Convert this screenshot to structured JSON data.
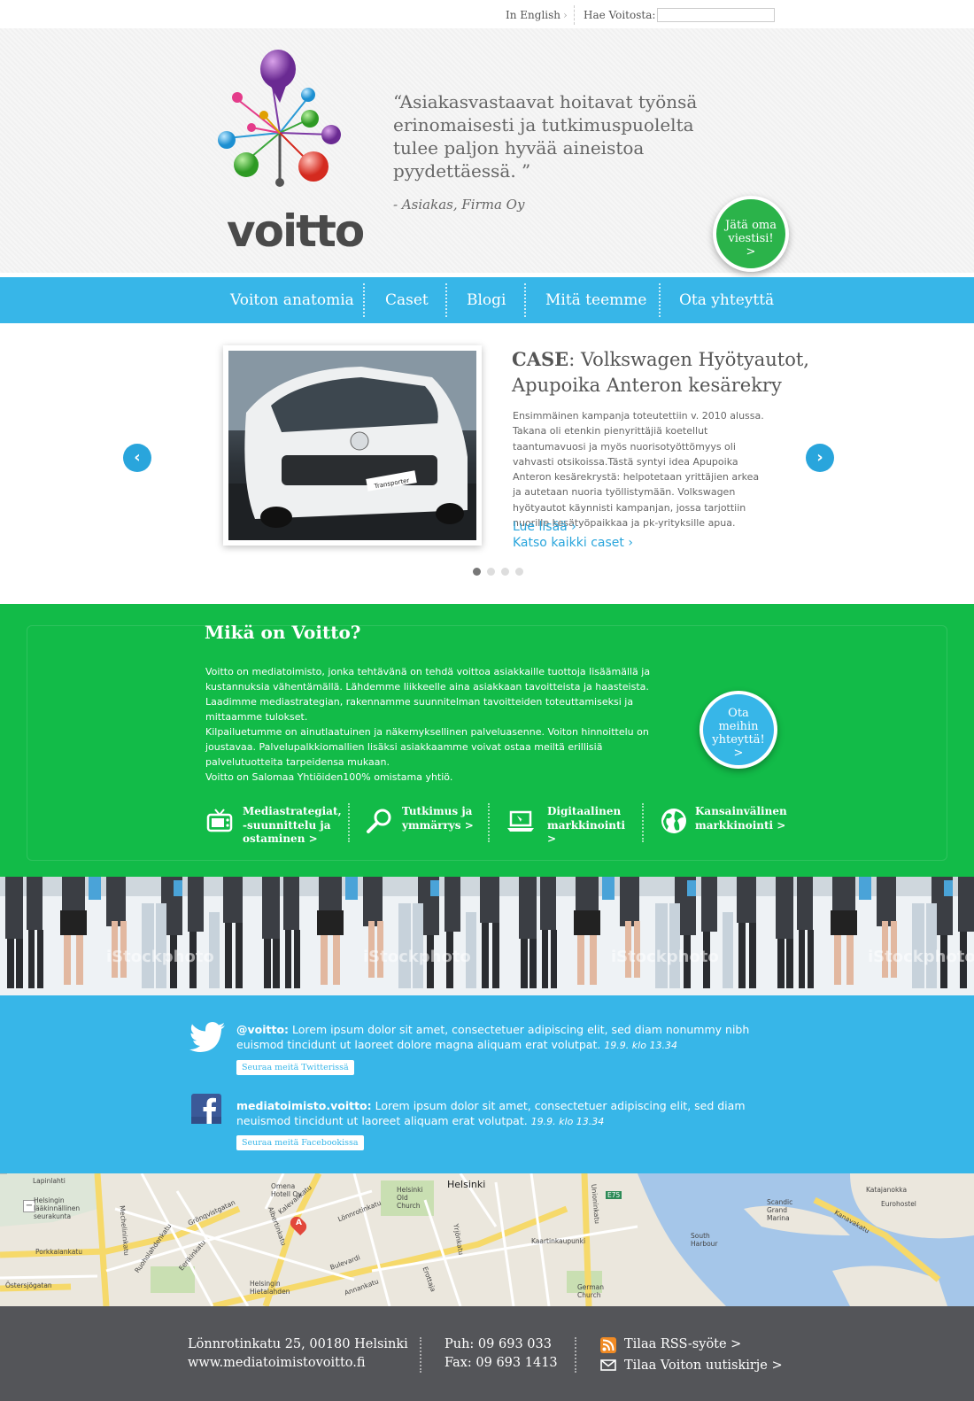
{
  "topbar": {
    "lang_link": "In English",
    "search_label": "Hae Voitosta:",
    "search_value": ""
  },
  "hero": {
    "logo_text": "voitto",
    "quote": "“Asiakasvastaavat hoitavat työnsä erinomaisesti ja tutkimuspuolelta tulee paljon hyvää aineistoa pyydettäessä. ”",
    "quote_author": "- Asiakas, Firma Oy",
    "cta": {
      "line1": "Jätä oma",
      "line2": "viestisi!",
      "arrow": ">"
    }
  },
  "nav": {
    "items": [
      {
        "label": "Voiton anatomia"
      },
      {
        "label": "Caset"
      },
      {
        "label": "Blogi"
      },
      {
        "label": "Mitä teemme"
      },
      {
        "label": "Ota yhteyttä"
      }
    ]
  },
  "slider": {
    "prev_arrow": "‹",
    "next_arrow": "›",
    "case_label": "CASE",
    "case_title": ": Volkswagen Hyötyautot, Apupoika Anteron kesärekry",
    "case_body": "Ensimmäinen kampanja toteutettiin v. 2010 alussa. Takana oli etenkin pienyrittäjiä koetellut taantumavuosi ja myös nuorisotyöttömyys oli vahvasti otsikoissa.Tästä syntyi idea Apupoika Anteron kesärekrystä: helpotetaan yrittäjien arkea ja autetaan nuoria työllistymään. Volkswagen hyötyautot käynnisti kampanjan, jossa tarjottiin nuorille kesätyöpaikkaa ja pk-yrityksille apua.",
    "read_more": "Lue lisää",
    "all_cases": "Katso kaikki caset",
    "plate_text": "Transporter",
    "active_slide": 1,
    "slide_count": 4
  },
  "about": {
    "title": "Mikä on Voitto?",
    "p1": "Voitto on mediatoimisto, jonka tehtävänä on tehdä voittoa asiakkaille tuottoja lisäämällä ja kustannuksia vähentämällä.  Lähdemme liikkeelle aina asiakkaan tavoitteista ja haasteista. Laadimme mediastrategian, rakennamme suunnitelman tavoitteiden toteuttamiseksi ja mittaamme tulokset.",
    "p2": "Kilpailuetumme on ainutlaatuinen ja näkemyksellinen palveluasenne. Voiton hinnoittelu on joustavaa. Palvelupalkkiomallien lisäksi asiakkaamme voivat ostaa meiltä erillisiä palvelutuotteita tarpeidensa mukaan.",
    "p3": "Voitto on Salomaa Yhtiöiden100% omistama yhtiö.",
    "cta": {
      "line1": "Ota",
      "line2": "meihin",
      "line3": "yhteyttä!",
      "arrow": ">"
    },
    "services": [
      {
        "icon": "tv-icon",
        "l1": "Mediastrategiat,",
        "l2": "-suunnittelu ja",
        "l3": "ostaminen  >"
      },
      {
        "icon": "magnifier-icon",
        "l1": "Tutkimus ja",
        "l2": "ymmärrys  >"
      },
      {
        "icon": "laptop-icon",
        "l1": "Digitaalinen",
        "l2": "markkinointi  >"
      },
      {
        "icon": "globe-icon",
        "l1": "Kansainvälinen",
        "l2": "markkinointi  >"
      }
    ]
  },
  "photo": {
    "watermark": "iStockphoto"
  },
  "social": {
    "twitter": {
      "handle": "@voitto:",
      "text": " Lorem ipsum dolor sit amet, consectetuer adipiscing elit, sed diam nonummy nibh euismod tincidunt ut laoreet dolore magna aliquam erat volutpat. ",
      "time": "19.9. klo 13.34",
      "follow": "Seuraa meitä Twitterissä"
    },
    "facebook": {
      "handle": "mediatoimisto.voitto:",
      "text": " Lorem ipsum dolor sit amet, consectetuer adipiscing elit, sed diam neuismod tincidunt ut laoreet aliquam erat volutpat. ",
      "time": "19.9. klo 13.34",
      "follow": "Seuraa meitä Facebookissa"
    }
  },
  "map": {
    "zoom_out": "−",
    "marker": "A",
    "labels": [
      "Lapinlahti",
      "Helsingin lääkinnällinen seurakunta",
      "Porkkalankatu",
      "Mechelininkatu",
      "Ruoholahdenkatu",
      "Eerikinkatu",
      "Kalevankatu",
      "Albertinkatu",
      "Lönnrotinkatu",
      "Bulevardi",
      "Yrjönkatu",
      "Helsinki",
      "Kaartinkaupunki",
      "Unioninkatu",
      "South Harbour",
      "Katajanokka",
      "Eurohostel",
      "Scandic Grand Marina",
      "Kanavakatu",
      "Östersjögatan",
      "Helsinki Old Church",
      "Omena Hotell Oy",
      "German Church",
      "Annankatu",
      "Erottaja",
      "Grönqvistgatan",
      "Helsingin Hietalahden",
      "E75"
    ]
  },
  "footer": {
    "address": "Lönnrotinkatu 25, 00180 Helsinki",
    "website": "www.mediatoimistovoitto.fi",
    "phone": "Puh: 09 693 033",
    "fax": "Fax: 09 693 1413",
    "rss": "Tilaa RSS-syöte >",
    "newsletter": "Tilaa Voiton uutiskirje >"
  },
  "colors": {
    "green": "#12bb48",
    "blue": "#37b6e8",
    "dark": "#545559",
    "link": "#29a5dc"
  }
}
